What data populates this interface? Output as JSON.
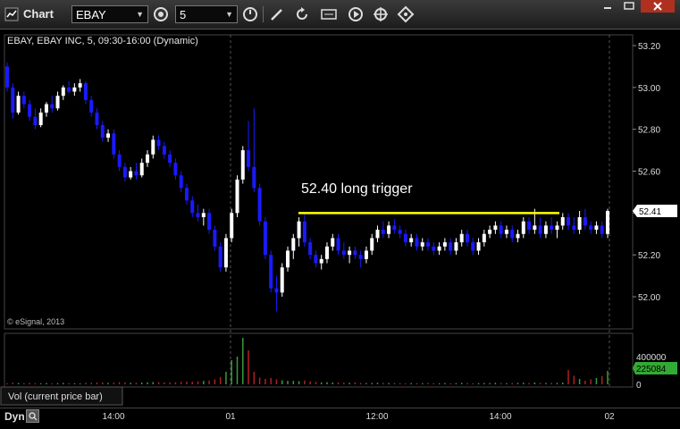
{
  "window": {
    "title": "Chart",
    "symbol": "EBAY",
    "interval": "5",
    "controls": [
      "minimize",
      "maximize",
      "close"
    ]
  },
  "toolbar_icons": [
    "link-icon",
    "interval-icon",
    "draw-icon",
    "refresh-icon",
    "study-icon",
    "play-icon",
    "cursor-icon"
  ],
  "chart": {
    "header": "EBAY, EBAY INC, 5, 09:30-16:00 (Dynamic)",
    "copyright": "© eSignal, 2013",
    "annotation": "52.40 long trigger",
    "last_price": "52.41",
    "volume_label": "Vol (current price bar)",
    "last_volume": "225084",
    "bottom_mode": "Dyn",
    "colors": {
      "up": "#ffffff",
      "down": "#1a1aff",
      "trigger": "#ffff00",
      "price_tag": "#ffffff",
      "vol_tag": "#33aa33"
    }
  },
  "chart_data": {
    "type": "candlestick",
    "price_ticks": [
      "53.20",
      "53.00",
      "52.80",
      "52.60",
      "52.40",
      "52.20",
      "52.00"
    ],
    "volume_ticks": [
      "400000",
      "200000",
      "0"
    ],
    "x_labels": [
      "14:00",
      "01",
      "12:00",
      "14:00",
      "02"
    ],
    "trigger_level": 52.4,
    "ylim": [
      51.9,
      53.25
    ],
    "ohlc": [
      [
        53.1,
        53.12,
        52.98,
        53.0
      ],
      [
        53.0,
        53.02,
        52.85,
        52.88
      ],
      [
        52.88,
        52.98,
        52.87,
        52.96
      ],
      [
        52.96,
        52.98,
        52.9,
        52.92
      ],
      [
        52.92,
        52.94,
        52.84,
        52.86
      ],
      [
        52.86,
        52.9,
        52.8,
        52.82
      ],
      [
        52.82,
        52.9,
        52.81,
        52.88
      ],
      [
        52.88,
        52.93,
        52.86,
        52.92
      ],
      [
        52.92,
        52.96,
        52.88,
        52.9
      ],
      [
        52.9,
        52.98,
        52.89,
        52.96
      ],
      [
        52.96,
        53.01,
        52.94,
        53.0
      ],
      [
        53.0,
        53.03,
        52.97,
        52.98
      ],
      [
        52.98,
        53.02,
        52.96,
        53.0
      ],
      [
        53.0,
        53.04,
        52.98,
        53.02
      ],
      [
        53.02,
        53.03,
        52.92,
        52.94
      ],
      [
        52.94,
        52.96,
        52.86,
        52.88
      ],
      [
        52.88,
        52.9,
        52.8,
        52.82
      ],
      [
        52.82,
        52.84,
        52.74,
        52.76
      ],
      [
        52.76,
        52.8,
        52.74,
        52.78
      ],
      [
        52.78,
        52.8,
        52.66,
        52.68
      ],
      [
        52.68,
        52.7,
        52.6,
        52.62
      ],
      [
        52.62,
        52.64,
        52.55,
        52.57
      ],
      [
        52.57,
        52.62,
        52.56,
        52.6
      ],
      [
        52.6,
        52.64,
        52.56,
        52.58
      ],
      [
        52.58,
        52.66,
        52.57,
        52.64
      ],
      [
        52.64,
        52.7,
        52.62,
        52.68
      ],
      [
        52.68,
        52.77,
        52.66,
        52.75
      ],
      [
        52.75,
        52.77,
        52.7,
        52.72
      ],
      [
        52.72,
        52.74,
        52.66,
        52.68
      ],
      [
        52.68,
        52.7,
        52.62,
        52.64
      ],
      [
        52.64,
        52.66,
        52.56,
        52.58
      ],
      [
        52.58,
        52.6,
        52.5,
        52.52
      ],
      [
        52.52,
        52.54,
        52.44,
        52.46
      ],
      [
        52.46,
        52.48,
        52.38,
        52.4
      ],
      [
        52.4,
        52.44,
        52.36,
        52.38
      ],
      [
        52.38,
        52.42,
        52.34,
        52.4
      ],
      [
        52.4,
        52.42,
        52.3,
        52.32
      ],
      [
        52.32,
        52.34,
        52.22,
        52.24
      ],
      [
        52.24,
        52.26,
        52.12,
        52.14
      ],
      [
        52.14,
        52.3,
        52.12,
        52.28
      ],
      [
        52.28,
        52.42,
        52.26,
        52.4
      ],
      [
        52.4,
        52.58,
        52.38,
        52.56
      ],
      [
        52.56,
        52.72,
        52.54,
        52.7
      ],
      [
        52.7,
        52.84,
        52.6,
        52.62
      ],
      [
        52.62,
        52.9,
        52.5,
        52.52
      ],
      [
        52.52,
        52.54,
        52.34,
        52.36
      ],
      [
        52.36,
        52.38,
        52.18,
        52.2
      ],
      [
        52.2,
        52.22,
        52.02,
        52.04
      ],
      [
        52.04,
        52.1,
        51.93,
        52.02
      ],
      [
        52.02,
        52.16,
        52.0,
        52.14
      ],
      [
        52.14,
        52.24,
        52.12,
        52.22
      ],
      [
        52.22,
        52.3,
        52.18,
        52.28
      ],
      [
        52.28,
        52.38,
        52.24,
        52.36
      ],
      [
        52.36,
        52.4,
        52.24,
        52.26
      ],
      [
        52.26,
        52.28,
        52.18,
        52.2
      ],
      [
        52.2,
        52.22,
        52.14,
        52.16
      ],
      [
        52.16,
        52.2,
        52.13,
        52.18
      ],
      [
        52.18,
        52.26,
        52.16,
        52.24
      ],
      [
        52.24,
        52.3,
        52.22,
        52.28
      ],
      [
        52.28,
        52.3,
        52.2,
        52.22
      ],
      [
        52.22,
        52.26,
        52.18,
        52.2
      ],
      [
        52.2,
        52.24,
        52.16,
        52.22
      ],
      [
        52.22,
        52.24,
        52.18,
        52.2
      ],
      [
        52.2,
        52.22,
        52.14,
        52.18
      ],
      [
        52.18,
        52.24,
        52.16,
        52.22
      ],
      [
        52.22,
        52.3,
        52.2,
        52.28
      ],
      [
        52.28,
        52.34,
        52.26,
        52.32
      ],
      [
        52.32,
        52.36,
        52.28,
        52.3
      ],
      [
        52.3,
        52.36,
        52.28,
        52.34
      ],
      [
        52.34,
        52.37,
        52.3,
        52.32
      ],
      [
        52.32,
        52.34,
        52.28,
        52.3
      ],
      [
        52.3,
        52.32,
        52.24,
        52.26
      ],
      [
        52.26,
        52.3,
        52.24,
        52.28
      ],
      [
        52.28,
        52.3,
        52.22,
        52.24
      ],
      [
        52.24,
        52.28,
        52.22,
        52.26
      ],
      [
        52.26,
        52.28,
        52.22,
        52.24
      ],
      [
        52.24,
        52.26,
        52.2,
        52.22
      ],
      [
        52.22,
        52.26,
        52.2,
        52.24
      ],
      [
        52.24,
        52.28,
        52.22,
        52.26
      ],
      [
        52.26,
        52.28,
        52.2,
        52.22
      ],
      [
        52.22,
        52.28,
        52.2,
        52.26
      ],
      [
        52.26,
        52.32,
        52.24,
        52.3
      ],
      [
        52.3,
        52.32,
        52.24,
        52.26
      ],
      [
        52.26,
        52.28,
        52.2,
        52.22
      ],
      [
        52.22,
        52.28,
        52.2,
        52.26
      ],
      [
        52.26,
        52.32,
        52.24,
        52.3
      ],
      [
        52.3,
        52.34,
        52.28,
        52.32
      ],
      [
        52.32,
        52.36,
        52.3,
        52.34
      ],
      [
        52.34,
        52.36,
        52.28,
        52.3
      ],
      [
        52.3,
        52.34,
        52.28,
        52.32
      ],
      [
        52.32,
        52.34,
        52.26,
        52.28
      ],
      [
        52.28,
        52.32,
        52.26,
        52.3
      ],
      [
        52.3,
        52.38,
        52.28,
        52.36
      ],
      [
        52.36,
        52.38,
        52.3,
        52.32
      ],
      [
        52.32,
        52.42,
        52.3,
        52.34
      ],
      [
        52.34,
        52.38,
        52.28,
        52.3
      ],
      [
        52.3,
        52.36,
        52.28,
        52.34
      ],
      [
        52.34,
        52.38,
        52.3,
        52.32
      ],
      [
        52.32,
        52.36,
        52.28,
        52.34
      ],
      [
        52.34,
        52.4,
        52.32,
        52.38
      ],
      [
        52.38,
        52.4,
        52.32,
        52.34
      ],
      [
        52.34,
        52.38,
        52.3,
        52.32
      ],
      [
        52.32,
        52.41,
        52.3,
        52.38
      ],
      [
        52.38,
        52.42,
        52.32,
        52.34
      ],
      [
        52.34,
        52.36,
        52.3,
        52.32
      ],
      [
        52.32,
        52.36,
        52.3,
        52.34
      ],
      [
        52.34,
        52.36,
        52.28,
        52.3
      ],
      [
        52.3,
        52.42,
        52.28,
        52.41
      ]
    ],
    "volume": [
      12000,
      18000,
      15000,
      14000,
      16000,
      13000,
      12000,
      15000,
      11000,
      14000,
      16000,
      13000,
      12000,
      11000,
      17000,
      18000,
      20000,
      22000,
      16000,
      19000,
      24000,
      21000,
      17000,
      18000,
      20000,
      22000,
      26000,
      24000,
      21000,
      20000,
      23000,
      27000,
      30000,
      28000,
      33000,
      38000,
      42000,
      55000,
      80000,
      140000,
      270000,
      310000,
      520000,
      380000,
      140000,
      75000,
      60000,
      70000,
      55000,
      45000,
      40000,
      38000,
      35000,
      42000,
      32000,
      26000,
      22000,
      24000,
      20000,
      21000,
      18000,
      17000,
      20000,
      16000,
      14000,
      15000,
      18000,
      16000,
      14000,
      15000,
      13000,
      12000,
      14000,
      13000,
      12000,
      15000,
      13000,
      12000,
      14000,
      11000,
      13000,
      16000,
      14000,
      12000,
      13000,
      15000,
      14000,
      17000,
      15000,
      13000,
      14000,
      16000,
      18000,
      15000,
      20000,
      16000,
      15000,
      17000,
      16000,
      20000,
      160000,
      95000,
      60000,
      40000,
      55000,
      70000,
      90000,
      150000
    ]
  }
}
